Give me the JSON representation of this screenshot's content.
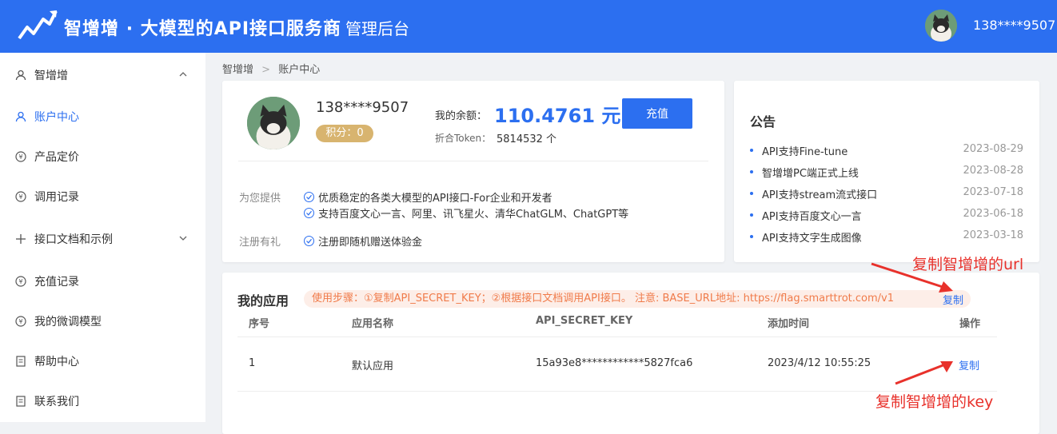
{
  "header": {
    "brand": "智增增",
    "tagline": "大模型的API接口服务商",
    "separator": "|",
    "admin_title": "管理后台",
    "username": "138****9507",
    "brand_color": "#2c6ff0"
  },
  "sidebar": {
    "items": [
      {
        "label": "智增增",
        "icon": "user-icon"
      },
      {
        "label": "账户中心",
        "icon": "user-icon"
      },
      {
        "label": "产品定价",
        "icon": "yen-circle-icon"
      },
      {
        "label": "调用记录",
        "icon": "yen-circle-icon"
      },
      {
        "label": "接口文档和示例",
        "icon": "plus-icon"
      },
      {
        "label": "充值记录",
        "icon": "yen-circle-icon"
      },
      {
        "label": "我的微调模型",
        "icon": "yen-circle-icon"
      },
      {
        "label": "帮助中心",
        "icon": "document-icon"
      },
      {
        "label": "联系我们",
        "icon": "document-icon"
      }
    ]
  },
  "breadcrumb": {
    "items": [
      "智增增",
      "账户中心"
    ],
    "separator": ">"
  },
  "profile": {
    "username": "138****9507",
    "points_label": "积分：0",
    "balance_label": "我的余额：",
    "balance_value": "110.4761 元",
    "token_label": "折合Token：",
    "token_value": "5814532  个",
    "recharge_button": "充值",
    "offer_label": "为您提供",
    "offers": [
      "优质稳定的各类大模型的API接口-For企业和开发者",
      "支持百度文心一言、阿里、讯飞星火、清华ChatGLM、ChatGPT等"
    ],
    "gift_label": "注册有礼",
    "gift_text": "注册即随机赠送体验金"
  },
  "notice": {
    "title": "公告",
    "items": [
      {
        "text": "API支持Fine-tune",
        "date": "2023-08-29"
      },
      {
        "text": "智增增PC端正式上线",
        "date": "2023-08-28"
      },
      {
        "text": "API支持stream流式接口",
        "date": "2023-07-18"
      },
      {
        "text": "API支持百度文心一言",
        "date": "2023-06-18"
      },
      {
        "text": "API支持文字生成图像",
        "date": "2023-03-18"
      }
    ]
  },
  "apps": {
    "title": "我的应用",
    "usage_tip": "使用步骤：①复制API_SECRET_KEY；②根据接口文档调用API接口。 注意: BASE_URL地址: https://flag.smarttrot.com/v1",
    "copy_url_label": "复制",
    "columns": [
      "序号",
      "应用名称",
      "API_SECRET_KEY",
      "添加时间",
      "操作"
    ],
    "rows": [
      {
        "index": "1",
        "name": "默认应用",
        "key": "15a93e8************5827fca6",
        "added": "2023/4/12 10:55:25",
        "action": "复制"
      }
    ]
  },
  "annotations": {
    "url_note": "复制智增增的url",
    "key_note": "复制智增增的key",
    "color": "#e8312b"
  }
}
